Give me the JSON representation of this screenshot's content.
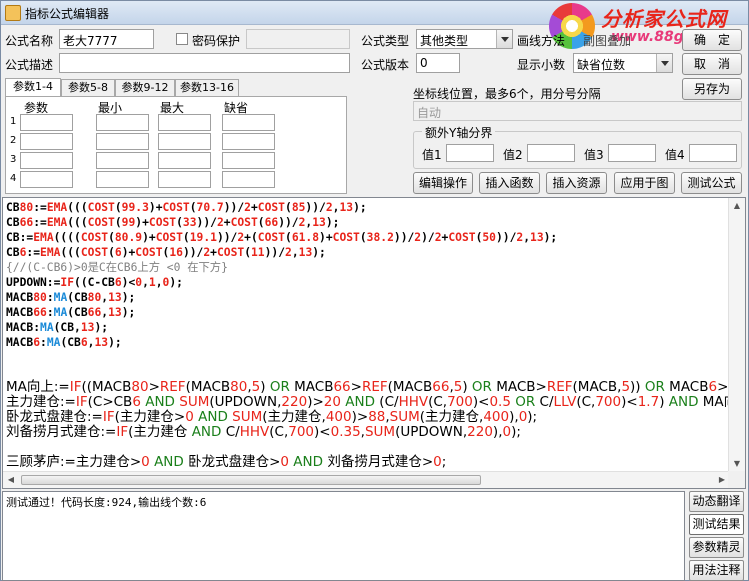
{
  "window": {
    "title": "指标公式编辑器"
  },
  "watermark": {
    "brand": "分析家公式网",
    "url": "www.88gs.com"
  },
  "form": {
    "name_label": "公式名称",
    "name_value": "老大7777",
    "password_label": "密码保护",
    "type_label": "公式类型",
    "type_value": "其他类型",
    "draw_method_label": "画线方法",
    "overlay_label": "副图叠加",
    "desc_label": "公式描述",
    "desc_value": "",
    "version_label": "公式版本",
    "version_value": "0",
    "decimal_label": "显示小数",
    "decimal_value": "缺省位数",
    "coord_label": "坐标线位置，最多6个，用分号分隔",
    "coord_value": "自动",
    "extra_axis_label": "额外Y轴分界",
    "extra_axis_fields": [
      {
        "label": "值1",
        "value": ""
      },
      {
        "label": "值2",
        "value": ""
      },
      {
        "label": "值3",
        "value": ""
      },
      {
        "label": "值4",
        "value": ""
      }
    ]
  },
  "buttons": {
    "confirm": "确　定",
    "cancel": "取　消",
    "save_as": "另存为",
    "edit_ops": "编辑操作",
    "insert_func": "插入函数",
    "insert_resource": "插入资源",
    "apply_to_chart": "应用于图",
    "test_formula": "测试公式"
  },
  "param_tabs": [
    "参数1-4",
    "参数5-8",
    "参数9-12",
    "参数13-16"
  ],
  "param_headers": [
    "参数",
    "最小",
    "最大",
    "缺省"
  ],
  "param_rows": [
    "1",
    "2",
    "3",
    "4"
  ],
  "code_lines": [
    "CB80:=EMA(((COST(99.3)+COST(70.7))/2+COST(85))/2,13);",
    "CB66:=EMA(((COST(99)+COST(33))/2+COST(66))/2,13);",
    "CB:=EMA((((COST(80.9)+COST(19.1))/2+(COST(61.8)+COST(38.2))/2)/2+COST(50))/2,13);",
    "CB6:=EMA(((COST(6)+COST(16))/2+COST(11))/2,13);",
    "{//(C-CB6)>0是C在CB6上方 <0 在下方}",
    "UPDOWN:=IF((C-CB6)<0,1,0);",
    "MACB80:MA(CB80,13);",
    "MACB66:MA(CB66,13);",
    "MACB:MA(CB,13);",
    "MACB6:MA(CB6,13);",
    "",
    "",
    "MA向上:=IF((MACB80>REF(MACB80,5) OR MACB66>REF(MACB66,5) OR MACB>REF(MACB,5)) OR MACB6>REF(MACB6,5),1,0);",
    "主力建仓:=IF(C>CB6 AND SUM(UPDOWN,220)>20 AND (C/HHV(C,700)<0.5 OR C/LLV(C,700)<1.7) AND MA向上,1,0);",
    "卧龙式盘建仓:=IF(主力建仓>0 AND SUM(主力建仓,400)>88,SUM(主力建仓,400),0);",
    "刘备捞月式建仓:=IF(主力建仓 AND C/HHV(C,700)<0.35,SUM(UPDOWN,220),0);",
    "",
    "三顾茅庐:=主力建仓>0 AND 卧龙式盘建仓>0 AND 刘备捞月式建仓>0;"
  ],
  "output": {
    "message": "测试通过！代码长度:924,输出线个数:6"
  },
  "side_buttons": [
    "动态翻译",
    "测试结果",
    "参数精灵",
    "用法注释"
  ],
  "colors": {
    "function": "#e8241a",
    "number": "#e8241a",
    "comment": "#808080",
    "ma": "#1a8ad8"
  }
}
